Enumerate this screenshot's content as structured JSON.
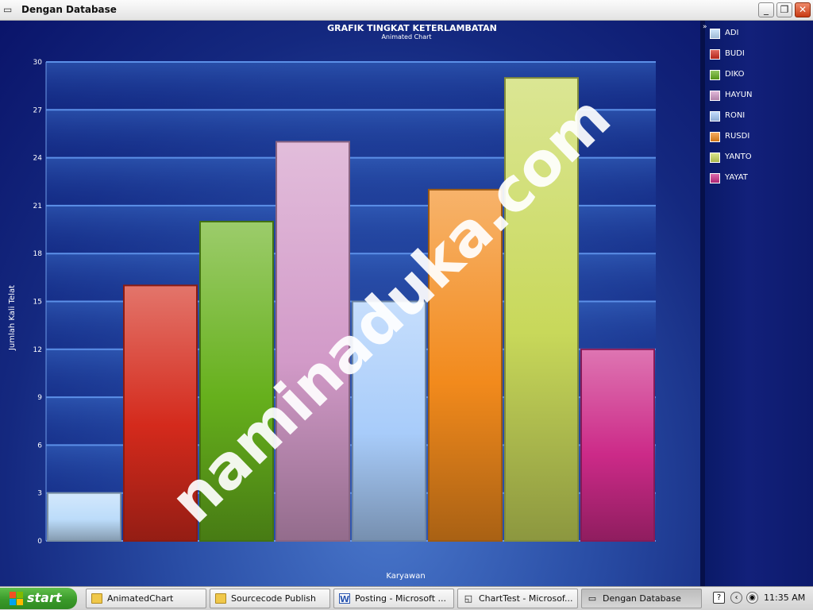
{
  "window": {
    "title": "Dengan Database",
    "minimize_label": "_",
    "restore_label": "❐",
    "close_label": "✕"
  },
  "chart_data": {
    "type": "bar",
    "title": "GRAFIK TINGKAT KETERLAMBATAN",
    "subtitle": "Animated Chart",
    "xlabel": "Karyawan",
    "ylabel": "Jumlah Kali Telat",
    "ylim": [
      0,
      30
    ],
    "yticks": [
      0,
      3,
      6,
      9,
      12,
      15,
      18,
      21,
      24,
      27,
      30
    ],
    "categories": [
      "ADI",
      "BUDI",
      "DIKO",
      "HAYUN",
      "RONI",
      "RUSDI",
      "YANTO",
      "YAYAT"
    ],
    "values": [
      3,
      16,
      20,
      25,
      15,
      22,
      29,
      12
    ],
    "colors": [
      "#bcdcfa",
      "#d42a1c",
      "#66b01c",
      "#d29ac8",
      "#a8ccfa",
      "#f28a1c",
      "#c8d85a",
      "#cc2a88"
    ],
    "legend_position": "right",
    "grid": true
  },
  "watermark": "naminaduka.com",
  "taskbar": {
    "start_label": "start",
    "tasks": [
      {
        "label": "AnimatedChart",
        "icon": "folder-icon"
      },
      {
        "label": "Sourcecode Publish",
        "icon": "folder-icon"
      },
      {
        "label": "Posting - Microsoft ...",
        "icon": "word-icon"
      },
      {
        "label": "ChartTest - Microsof...",
        "icon": "app-icon"
      },
      {
        "label": "Dengan Database",
        "icon": "window-icon"
      }
    ],
    "clock": "11:35 AM"
  }
}
